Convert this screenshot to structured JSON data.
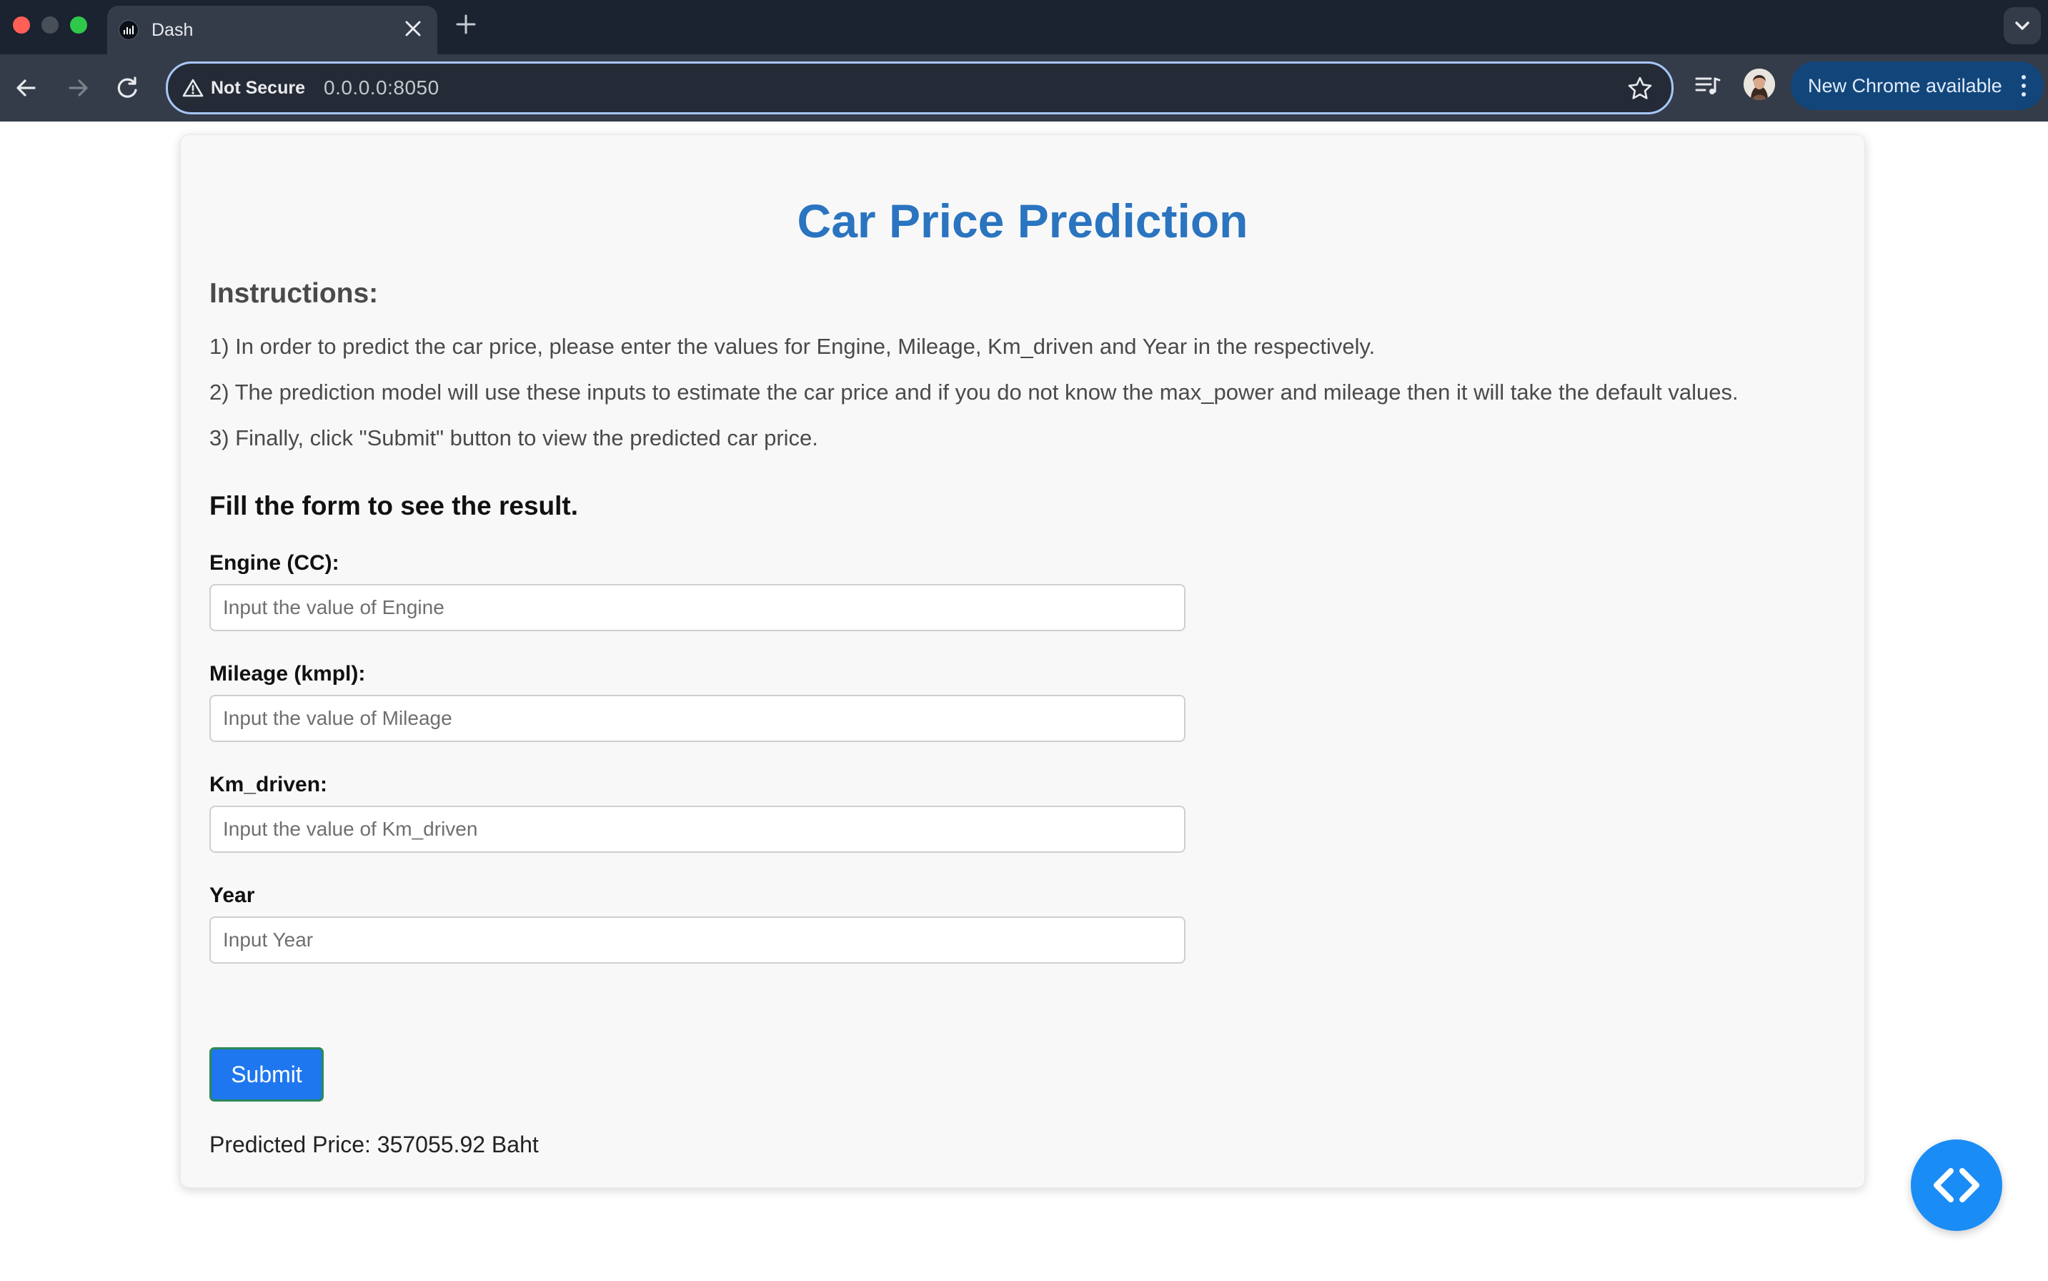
{
  "browser": {
    "tab_title": "Dash",
    "security_label": "Not Secure",
    "url": "0.0.0.0:8050",
    "update_button": "New Chrome available"
  },
  "page": {
    "title": "Car Price Prediction",
    "instructions_heading": "Instructions:",
    "instructions": [
      "1) In order to predict the car price, please enter the values for Engine, Mileage, Km_driven and Year in the respectively.",
      "2) The prediction model will use these inputs to estimate the car price and if you do not know the max_power and mileage then it will take the default values.",
      "3) Finally, click \"Submit\" button to view the predicted car price."
    ],
    "form_heading": "Fill the form to see the result.",
    "fields": [
      {
        "label": "Engine (CC):",
        "placeholder": "Input the value of Engine",
        "value": ""
      },
      {
        "label": "Mileage (kmpl):",
        "placeholder": "Input the value of Mileage",
        "value": ""
      },
      {
        "label": "Km_driven:",
        "placeholder": "Input the value of Km_driven",
        "value": ""
      },
      {
        "label": "Year",
        "placeholder": "Input Year",
        "value": ""
      }
    ],
    "submit_label": "Submit",
    "result_text": "Predicted Price: 357055.92 Baht"
  },
  "icons": {
    "back": "arrow-left-icon",
    "forward": "arrow-right-icon",
    "reload": "reload-icon",
    "warning": "warning-triangle-icon",
    "bookmark": "star-icon",
    "media": "media-queue-icon",
    "menu": "kebab-menu-icon",
    "devtools": "code-brackets-icon"
  },
  "colors": {
    "title": "#2a74c0",
    "submit": "#1f77ef",
    "devtools_fab": "#1a8cf5",
    "update_chip": "#12467b"
  }
}
